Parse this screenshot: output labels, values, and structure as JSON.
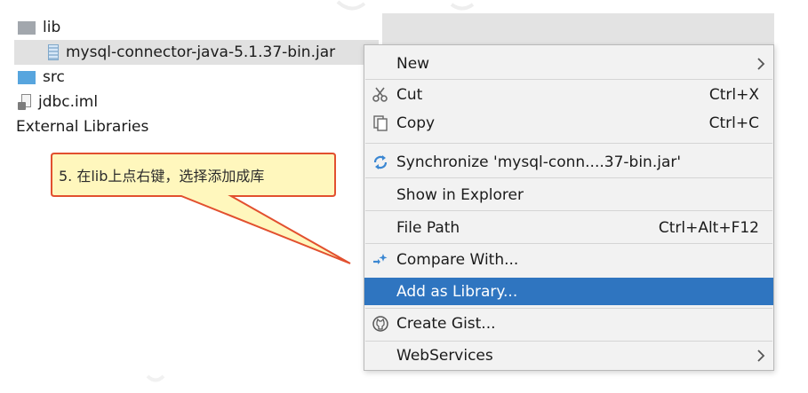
{
  "project_tree": {
    "items": [
      {
        "label": "lib",
        "icon": "folder-icon"
      },
      {
        "label": "mysql-connector-java-5.1.37-bin.jar",
        "icon": "jar-icon",
        "selected": true
      },
      {
        "label": "src",
        "icon": "folder-icon"
      },
      {
        "label": "jdbc.iml",
        "icon": "iml-file-icon"
      },
      {
        "label": "External Libraries"
      }
    ]
  },
  "context_menu": {
    "items": [
      {
        "label": "New",
        "submenu": true
      },
      {
        "label": "Cut",
        "shortcut": "Ctrl+X",
        "icon": "cut-icon"
      },
      {
        "label": "Copy",
        "shortcut": "Ctrl+C",
        "icon": "copy-icon"
      },
      {
        "label": "Synchronize 'mysql-conn....37-bin.jar'",
        "icon": "sync-icon"
      },
      {
        "label": "Show in Explorer"
      },
      {
        "label": "File Path",
        "shortcut": "Ctrl+Alt+F12"
      },
      {
        "label": "Compare With...",
        "icon": "compare-icon"
      },
      {
        "label": "Add as Library...",
        "highlighted": true
      },
      {
        "label": "Create Gist...",
        "icon": "gist-icon"
      },
      {
        "label": "WebServices",
        "submenu": true
      }
    ]
  },
  "callout": {
    "text": "5. 在lib上点右键，选择添加成库",
    "fill_color": "#fff7bd",
    "border_color": "#e2502f"
  },
  "colors": {
    "highlight": "#2f75c0",
    "menu_bg": "#f2f2f2",
    "selected_row": "#e1e1e1"
  }
}
